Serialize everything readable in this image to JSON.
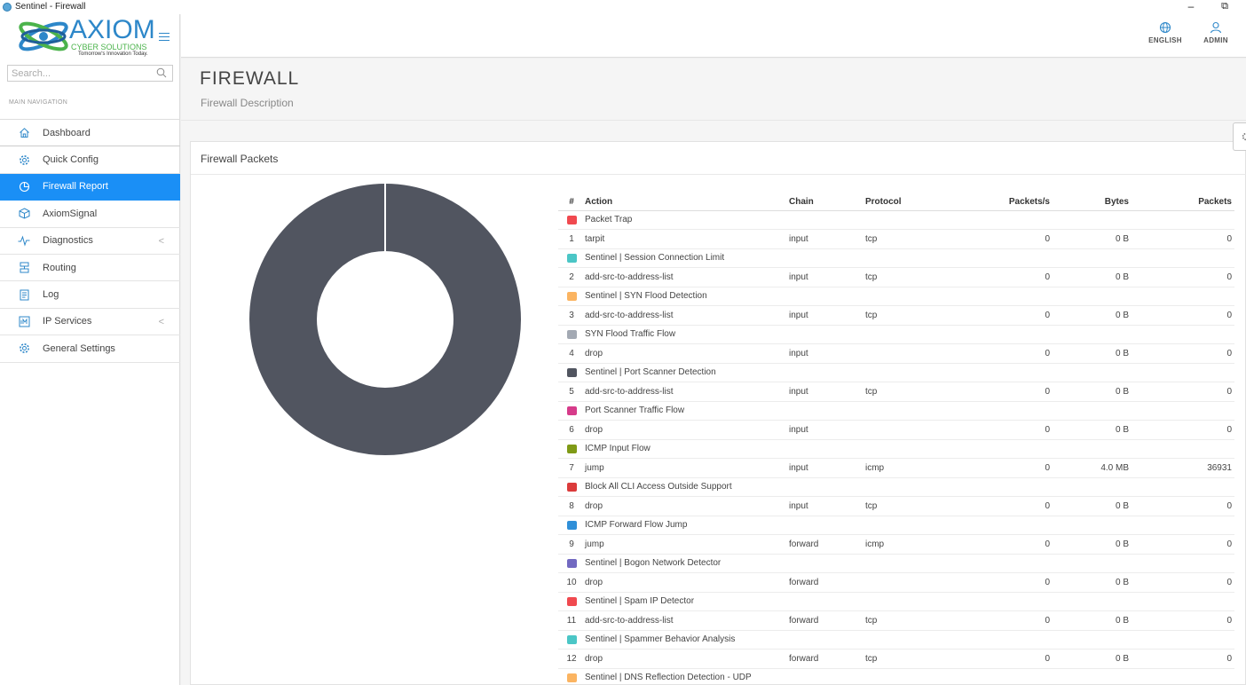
{
  "window": {
    "title": "Sentinel - Firewall",
    "minimize": "–",
    "restore": "⧉"
  },
  "brand": {
    "name": "AXIOM",
    "sub": "CYBER SOLUTIONS",
    "tagline": "Tomorrow's Innovation Today.",
    "primary": "#2d87c9",
    "accent": "#4bb34b"
  },
  "topbar": {
    "language": {
      "label": "ENGLISH",
      "icon": "globe-icon"
    },
    "user": {
      "label": "ADMIN",
      "icon": "user-icon"
    }
  },
  "sidebar": {
    "search_placeholder": "Search...",
    "nav_header": "MAIN NAVIGATION",
    "items": [
      {
        "label": "Dashboard",
        "icon": "home-icon",
        "active": false,
        "submenu": false
      },
      {
        "label": "Quick Config",
        "icon": "gear-icon",
        "active": false,
        "submenu": false
      },
      {
        "label": "Firewall Report",
        "icon": "pie-chart-icon",
        "active": true,
        "submenu": false
      },
      {
        "label": "AxiomSignal",
        "icon": "cube-icon",
        "active": false,
        "submenu": false
      },
      {
        "label": "Diagnostics",
        "icon": "pulse-icon",
        "active": false,
        "submenu": true
      },
      {
        "label": "Routing",
        "icon": "routing-icon",
        "active": false,
        "submenu": false
      },
      {
        "label": "Log",
        "icon": "log-icon",
        "active": false,
        "submenu": false
      },
      {
        "label": "IP Services",
        "icon": "ip-services-icon",
        "active": false,
        "submenu": true
      },
      {
        "label": "General Settings",
        "icon": "gear-icon",
        "active": false,
        "submenu": false
      }
    ],
    "chevron": "<",
    "active_color": "#1a8ff6"
  },
  "page": {
    "title": "FIREWALL",
    "description": "Firewall Description"
  },
  "panel": {
    "title": "Firewall Packets",
    "donut_color": "#515560",
    "table": {
      "headers": [
        "#",
        "Action",
        "Chain",
        "Protocol",
        "Packets/s",
        "Bytes",
        "Packets"
      ],
      "rules": [
        {
          "name": "Packet Trap",
          "color": "#f0494f",
          "num": "1",
          "action": "tarpit",
          "chain": "input",
          "protocol": "tcp",
          "pps": "0",
          "bytes": "0 B",
          "packets": "0"
        },
        {
          "name": "Sentinel | Session Connection Limit",
          "color": "#4bc6c6",
          "num": "2",
          "action": "add-src-to-address-list",
          "chain": "input",
          "protocol": "tcp",
          "pps": "0",
          "bytes": "0 B",
          "packets": "0"
        },
        {
          "name": "Sentinel | SYN Flood Detection",
          "color": "#fbb461",
          "num": "3",
          "action": "add-src-to-address-list",
          "chain": "input",
          "protocol": "tcp",
          "pps": "0",
          "bytes": "0 B",
          "packets": "0"
        },
        {
          "name": "SYN Flood Traffic Flow",
          "color": "#a3a9b3",
          "num": "4",
          "action": "drop",
          "chain": "input",
          "protocol": "",
          "pps": "0",
          "bytes": "0 B",
          "packets": "0"
        },
        {
          "name": "Sentinel | Port Scanner Detection",
          "color": "#515560",
          "num": "5",
          "action": "add-src-to-address-list",
          "chain": "input",
          "protocol": "tcp",
          "pps": "0",
          "bytes": "0 B",
          "packets": "0"
        },
        {
          "name": "Port Scanner Traffic Flow",
          "color": "#d63b8a",
          "num": "6",
          "action": "drop",
          "chain": "input",
          "protocol": "",
          "pps": "0",
          "bytes": "0 B",
          "packets": "0"
        },
        {
          "name": "ICMP Input Flow",
          "color": "#7f9a16",
          "num": "7",
          "action": "jump",
          "chain": "input",
          "protocol": "icmp",
          "pps": "0",
          "bytes": "4.0 MB",
          "packets": "36931"
        },
        {
          "name": "Block All CLI Access Outside Support",
          "color": "#db3b3b",
          "num": "8",
          "action": "drop",
          "chain": "input",
          "protocol": "tcp",
          "pps": "0",
          "bytes": "0 B",
          "packets": "0"
        },
        {
          "name": "ICMP Forward Flow Jump",
          "color": "#2f8fd8",
          "num": "9",
          "action": "jump",
          "chain": "forward",
          "protocol": "icmp",
          "pps": "0",
          "bytes": "0 B",
          "packets": "0"
        },
        {
          "name": "Sentinel | Bogon Network Detector",
          "color": "#7269c1",
          "num": "10",
          "action": "drop",
          "chain": "forward",
          "protocol": "",
          "pps": "0",
          "bytes": "0 B",
          "packets": "0"
        },
        {
          "name": "Sentinel | Spam IP Detector",
          "color": "#f0494f",
          "num": "11",
          "action": "add-src-to-address-list",
          "chain": "forward",
          "protocol": "tcp",
          "pps": "0",
          "bytes": "0 B",
          "packets": "0"
        },
        {
          "name": "Sentinel | Spammer Behavior Analysis",
          "color": "#4bc6c6",
          "num": "12",
          "action": "drop",
          "chain": "forward",
          "protocol": "tcp",
          "pps": "0",
          "bytes": "0 B",
          "packets": "0"
        },
        {
          "name": "Sentinel | DNS Reflection Detection - UDP",
          "color": "#fbb461"
        }
      ]
    }
  }
}
